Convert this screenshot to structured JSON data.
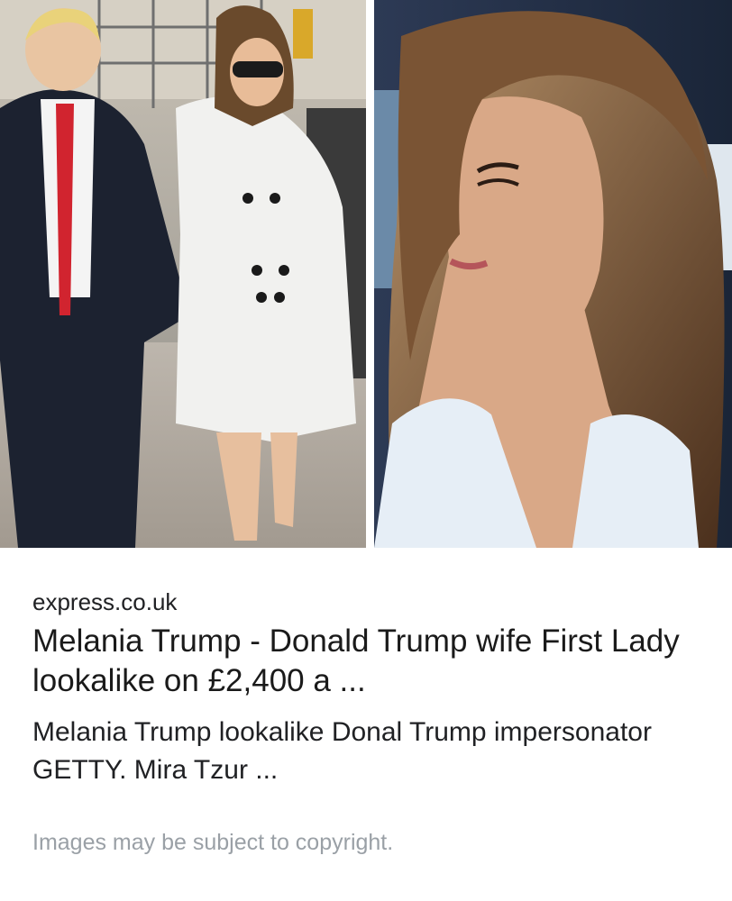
{
  "result": {
    "source": "express.co.uk",
    "title": "Melania Trump - Donald Trump wife First Lady lookalike on £2,400 a ...",
    "description": "Melania Trump lookalike Donal Trump impersonator GETTY. Mira Tzur ...",
    "copyright_notice": "Images may be subject to copyright."
  },
  "images": {
    "left": "photo-couple-walking",
    "right": "photo-woman-closeup"
  }
}
